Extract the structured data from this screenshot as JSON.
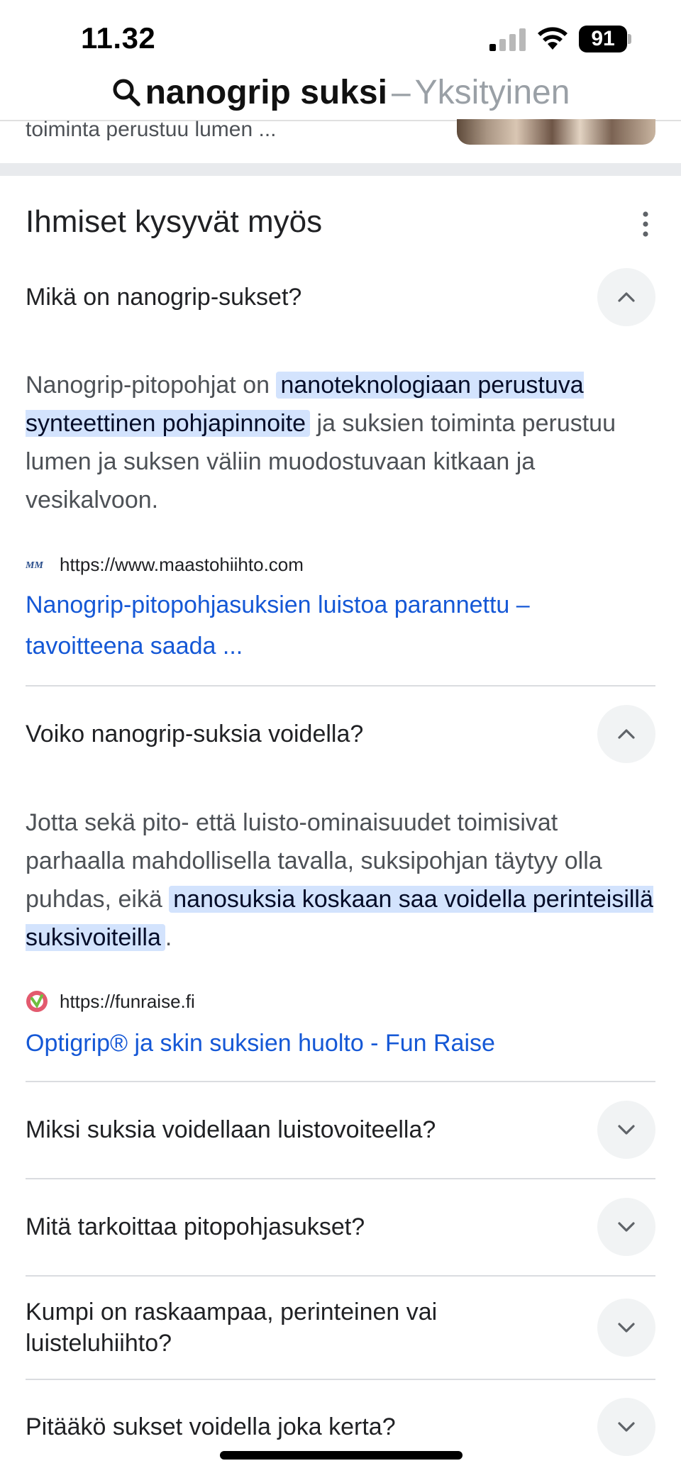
{
  "status_bar": {
    "time": "11.32",
    "battery": "91"
  },
  "title_bar": {
    "query": "nanogrip suksi",
    "separator": "–",
    "mode": "Yksityinen"
  },
  "previous_result": {
    "snippet_fragment": "toiminta perustuu lumen ..."
  },
  "people_also_ask": {
    "heading": "Ihmiset kysyvät myös",
    "questions": [
      {
        "question": "Mikä on nanogrip-sukset?",
        "expanded": true,
        "answer_pre": "Nanogrip-pitopohjat on ",
        "answer_highlight": "nanoteknologiaan perustuva synteettinen pohjapinnoite",
        "answer_post": " ja suksien toiminta perustuu lumen ja suksen väliin muodostuvaan kitkaan ja vesikalvoon.",
        "source_url": "https://www.maastohiihto.com",
        "source_title": "Nanogrip-pitopohjasuksien luistoa parannettu – tavoitteena saada ..."
      },
      {
        "question": "Voiko nanogrip-suksia voidella?",
        "expanded": true,
        "answer_pre": "Jotta sekä pito- että luisto-ominaisuudet toimisivat parhaalla mahdollisella tavalla, suksipohjan täytyy olla puhdas, eikä ",
        "answer_highlight": "nanosuksia koskaan saa voidella perinteisillä suksivoiteilla",
        "answer_post": ".",
        "source_url": "https://funraise.fi",
        "source_title": "Optigrip® ja skin suksien huolto - Fun Raise"
      },
      {
        "question": "Miksi suksia voidellaan luistovoiteella?",
        "expanded": false
      },
      {
        "question": "Mitä tarkoittaa pitopohjasukset?",
        "expanded": false
      },
      {
        "question": "Kumpi on raskaampaa, perinteinen vai luisteluhiihto?",
        "expanded": false
      },
      {
        "question": "Pitääkö sukset voidella joka kerta?",
        "expanded": false
      }
    ]
  },
  "icons": {
    "search": "search-icon",
    "more": "more-vert-icon",
    "expand_less": "chevron-up-icon",
    "expand_more": "chevron-down-icon"
  },
  "colors": {
    "highlight_bg": "#d3e3fd",
    "link": "#1558d6",
    "toggle_bg": "#f1f3f4"
  }
}
